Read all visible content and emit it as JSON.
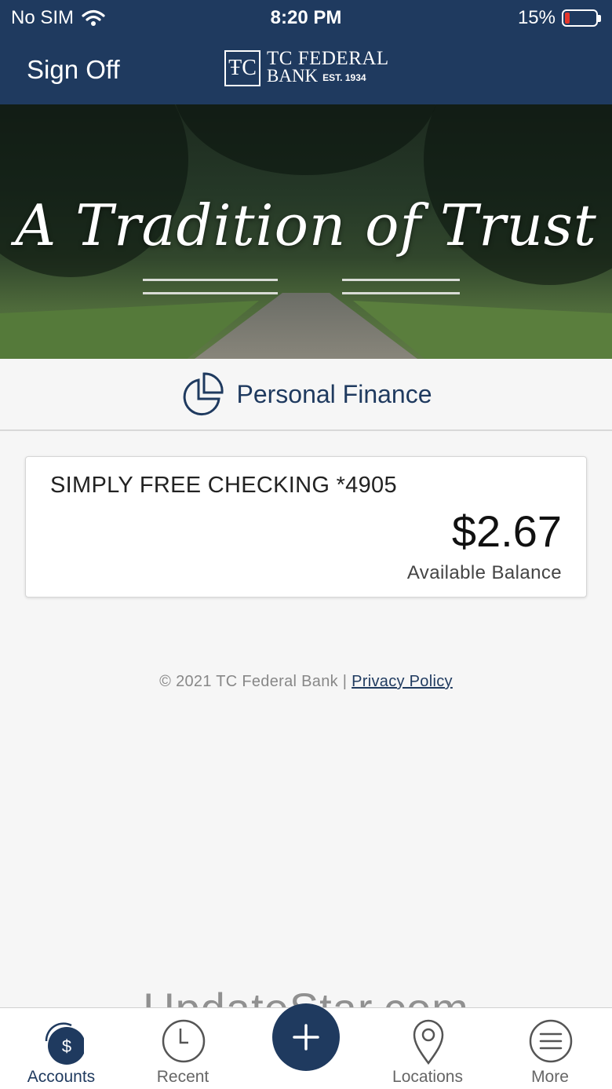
{
  "status_bar": {
    "carrier": "No SIM",
    "time": "8:20 PM",
    "battery": "15%",
    "icons": [
      "wifi-icon",
      "battery-icon"
    ]
  },
  "header": {
    "sign_off": "Sign Off",
    "logo": {
      "mark": "ŦC",
      "line1": "TC FEDERAL",
      "line2": "BANK",
      "est": "EST. 1934"
    },
    "background_color": "#1f3a5f"
  },
  "banner": {
    "tagline": "A Tradition of Trust"
  },
  "personal_finance": {
    "label": "Personal Finance",
    "icon": "pie-chart-icon"
  },
  "account": {
    "name": "SIMPLY FREE CHECKING *4905",
    "balance": "$2.67",
    "balance_label": "Available Balance"
  },
  "footer": {
    "copyright": "© 2021 TC Federal Bank |",
    "privacy": "Privacy Policy"
  },
  "watermark": "UpdateStar.com",
  "tabbar": {
    "tabs": [
      {
        "label": "Accounts",
        "icon": "dollar-circle-icon",
        "active": true
      },
      {
        "label": "Recent",
        "icon": "clock-icon",
        "active": false
      },
      {
        "label": "",
        "icon": "plus-icon",
        "active": false
      },
      {
        "label": "Locations",
        "icon": "map-pin-icon",
        "active": false
      },
      {
        "label": "More",
        "icon": "menu-icon",
        "active": false
      }
    ]
  },
  "colors": {
    "brand": "#1f3a5f",
    "battery_low": "#e5372b"
  }
}
